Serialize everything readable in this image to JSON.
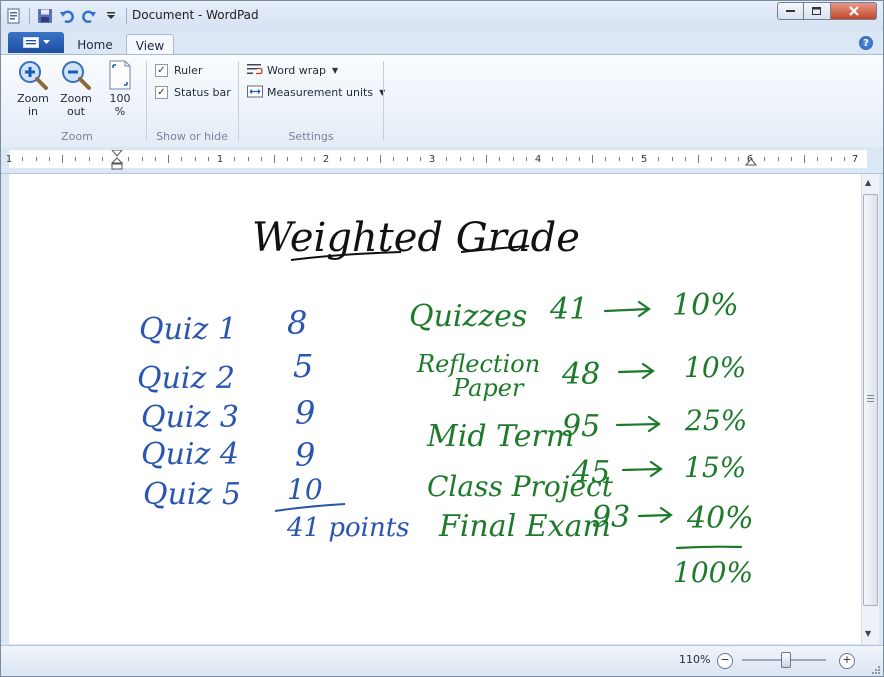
{
  "window": {
    "title": "Document - WordPad"
  },
  "tabs": [
    {
      "label": "Home",
      "active": false
    },
    {
      "label": "View",
      "active": true
    }
  ],
  "help_label": "?",
  "ribbon": {
    "zoom": {
      "zoom_in": "Zoom\nin",
      "zoom_in_l1": "Zoom",
      "zoom_in_l2": "in",
      "zoom_out_l1": "Zoom",
      "zoom_out_l2": "out",
      "p100_l1": "100",
      "p100_l2": "%",
      "group_label": "Zoom"
    },
    "show_hide": {
      "ruler": "Ruler",
      "status_bar": "Status bar",
      "ruler_checked": true,
      "status_checked": true,
      "group_label": "Show or hide"
    },
    "settings": {
      "word_wrap": "Word wrap",
      "measurement_units": "Measurement units",
      "group_label": "Settings"
    }
  },
  "ruler": {
    "numbers": [
      "1",
      "1",
      "2",
      "3",
      "4",
      "5",
      "6",
      "7"
    ]
  },
  "document": {
    "title": "Weighted Grade",
    "quizzes": [
      {
        "label": "Quiz 1",
        "score": "8"
      },
      {
        "label": "Quiz 2",
        "score": "5"
      },
      {
        "label": "Quiz 3",
        "score": "9"
      },
      {
        "label": "Quiz 4",
        "score": "9"
      },
      {
        "label": "Quiz 5",
        "score": "10"
      }
    ],
    "quiz_total": "41 points",
    "weights": [
      {
        "category": "Quizzes",
        "score": "41",
        "weight": "10%"
      },
      {
        "category": "Reflection Paper",
        "category_l1": "Reflection",
        "category_l2": "Paper",
        "score": "48",
        "weight": "10%"
      },
      {
        "category": "Mid Term",
        "score": "95",
        "weight": "25%"
      },
      {
        "category": "Class Project",
        "score": "45",
        "weight": "15%"
      },
      {
        "category": "Final Exam",
        "score": "93",
        "weight": "40%"
      }
    ],
    "weight_total": "100%"
  },
  "status_bar": {
    "zoom_level": "110%",
    "zoom_minus": "−",
    "zoom_plus": "+"
  },
  "colors": {
    "ink_black": "#111111",
    "ink_blue": "#2a55b0",
    "ink_green": "#1d7a2b",
    "accent": "#1e4fa0"
  }
}
